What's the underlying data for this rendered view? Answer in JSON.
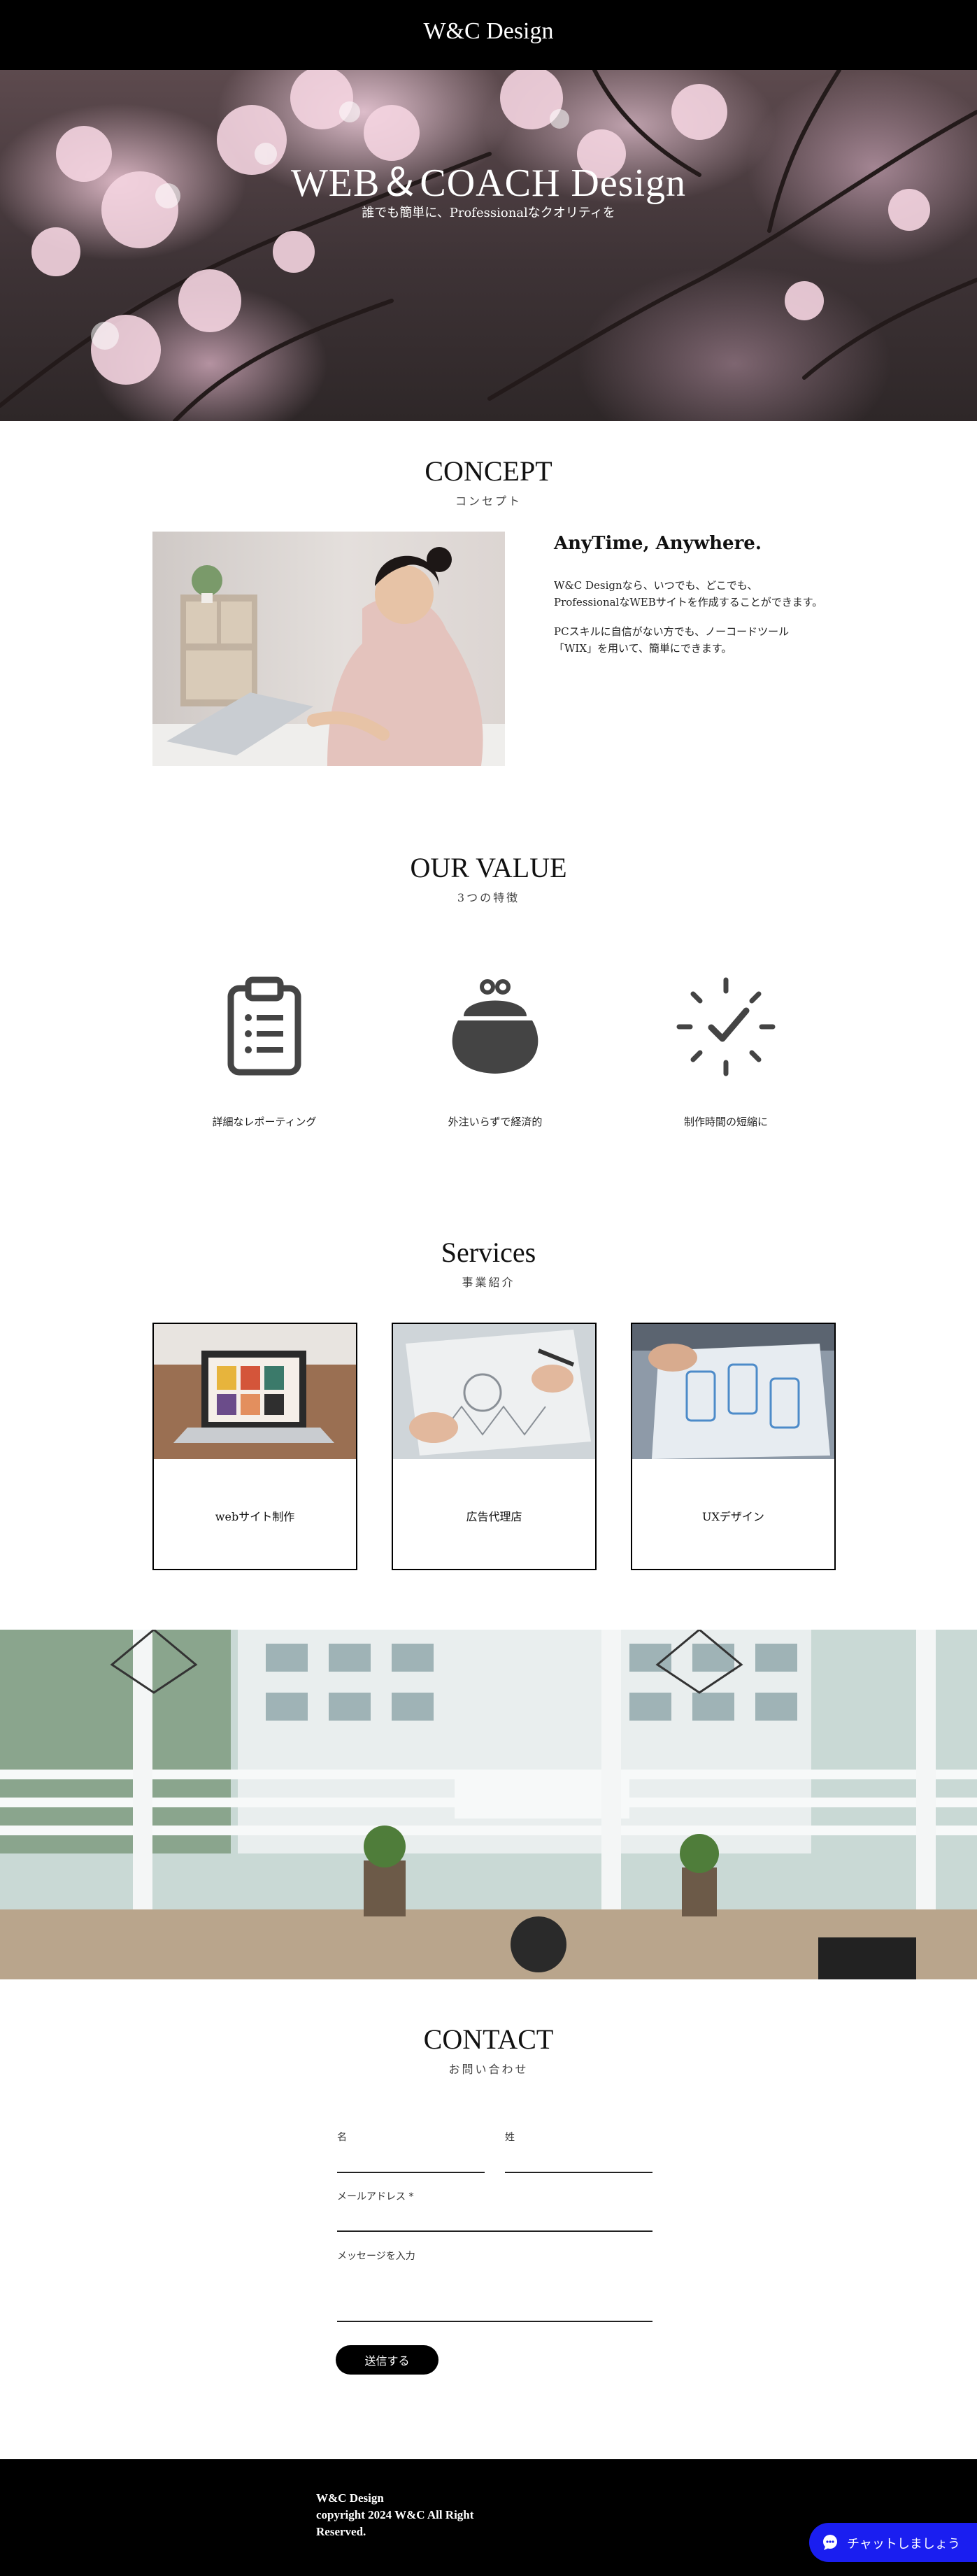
{
  "header": {
    "brand": "W&C Design"
  },
  "hero": {
    "title": "WEB＆COACH Design",
    "subtitle": "誰でも簡単に、Professionalなクオリティを"
  },
  "concept": {
    "title": "CONCEPT",
    "subtitle": "コンセプト",
    "heading": "AnyTime, Anywhere.",
    "p1_line1": "W&C Designなら、いつでも、どこでも、",
    "p1_line2": "ProfessionalなWEBサイトを作成することができます。",
    "p2_line1": "PCスキルに自信がない方でも、ノーコードツール",
    "p2_line2": "「WIX」を用いて、簡単にできます。"
  },
  "value": {
    "title": "OUR VALUE",
    "subtitle": "3つの特徴",
    "items": [
      {
        "icon": "clipboard-list-icon",
        "label": "詳細なレポーティング"
      },
      {
        "icon": "coin-purse-icon",
        "label": "外注いらずで経済的"
      },
      {
        "icon": "clock-check-icon",
        "label": "制作時間の短縮に"
      }
    ]
  },
  "services": {
    "title": "Services",
    "subtitle": "事業紹介",
    "items": [
      {
        "label": "webサイト制作"
      },
      {
        "label": "広告代理店"
      },
      {
        "label": "UXデザイン"
      }
    ]
  },
  "contact": {
    "title": "CONTACT",
    "subtitle": "お問い合わせ",
    "first_name_label": "名",
    "last_name_label": "姓",
    "email_label": "メールアドレス *",
    "message_label": "メッセージを入力",
    "submit_label": "送信する"
  },
  "footer": {
    "line1": "W&C Design",
    "line2": "copyright 2024 W&C All Right",
    "line3": "Reserved."
  },
  "chat": {
    "label": "チャットしましょう"
  },
  "colors": {
    "header_bg": "#000000",
    "chat_bg": "#1a1ef0",
    "text": "#222222"
  }
}
